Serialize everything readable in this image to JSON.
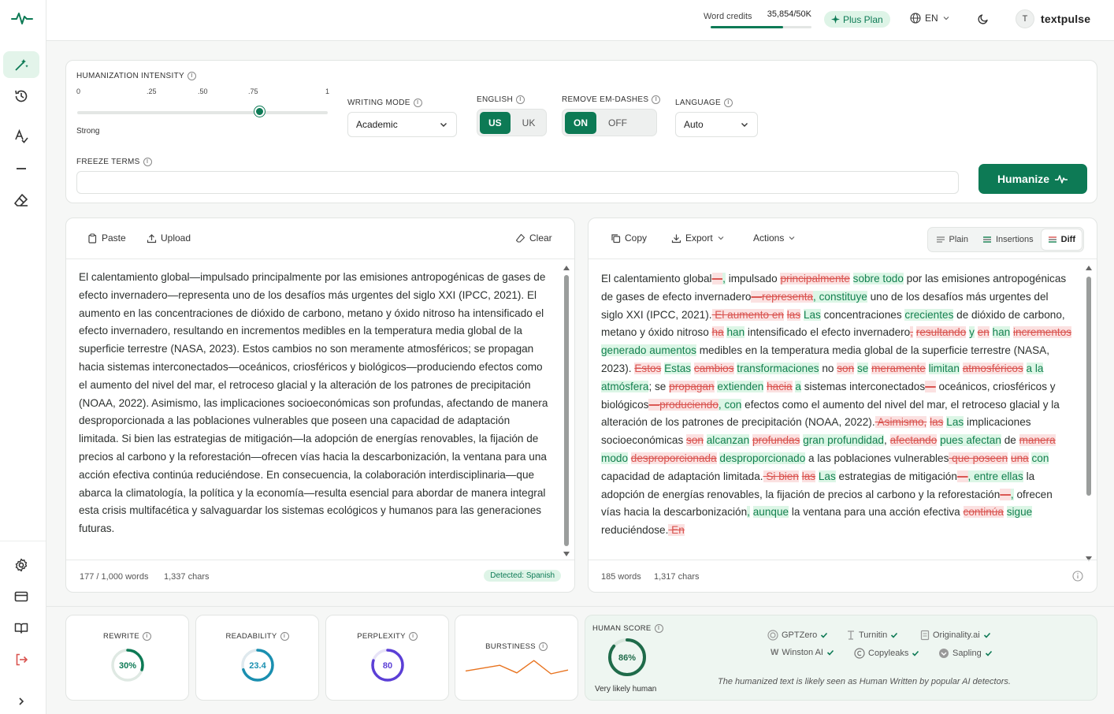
{
  "colors": {
    "accent": "#0d7a55",
    "deleted": "#d9534f",
    "inserted": "#13804f"
  },
  "topbar": {
    "credits_label": "Word credits",
    "credits_value": "35,854/50K",
    "credits_fraction": 0.717,
    "plan": "Plus Plan",
    "language": "EN",
    "user_initial": "T",
    "username": "textpulse"
  },
  "sidebar": {
    "items": [
      "magic-wand-icon",
      "history-icon",
      "spellcheck-icon",
      "dash-icon",
      "eraser-icon",
      "settings-icon",
      "billing-icon",
      "docs-icon",
      "logout-icon",
      "expand-icon"
    ]
  },
  "settings": {
    "intensity_label": "HUMANIZATION INTENSITY",
    "ticks": [
      "0",
      ".25",
      ".50",
      ".75",
      "1"
    ],
    "intensity_value": 0.73,
    "intensity_name": "Strong",
    "writing_mode_label": "WRITING MODE",
    "writing_mode": "Academic",
    "english_label": "ENGLISH",
    "english_opts": [
      "US",
      "UK"
    ],
    "emdash_label": "REMOVE EM-DASHES",
    "emdash_opts": [
      "ON",
      "OFF"
    ],
    "language_label": "LANGUAGE",
    "language": "Auto",
    "freeze_label": "FREEZE TERMS",
    "freeze_value": "",
    "humanize": "Humanize"
  },
  "input": {
    "paste": "Paste",
    "upload": "Upload",
    "clear": "Clear",
    "text": "El calentamiento global—impulsado principalmente por las emisiones antropogénicas de gases de efecto invernadero—representa uno de los desafíos más urgentes del siglo XXI (IPCC, 2021). El aumento en las concentraciones de dióxido de carbono, metano y óxido nitroso ha intensificado el efecto invernadero, resultando en incrementos medibles en la temperatura media global de la superficie terrestre (NASA, 2023). Estos cambios no son meramente atmosféricos; se propagan hacia sistemas interconectados—oceánicos, criosféricos y biológicos—produciendo efectos como el aumento del nivel del mar, el retroceso glacial y la alteración de los patrones de precipitación (NOAA, 2022). Asimismo, las implicaciones socioeconómicas son profundas, afectando de manera desproporcionada a las poblaciones vulnerables que poseen una capacidad de adaptación limitada. Si bien las estrategias de mitigación—la adopción de energías renovables, la fijación de precios al carbono y la reforestación—ofrecen vías hacia la descarbonización, la ventana para una acción efectiva continúa reduciéndose. En consecuencia, la colaboración interdisciplinaria—que abarca la climatología, la política y la economía—resulta esencial para abordar de manera integral esta crisis multifacética y salvaguardar los sistemas ecológicos y humanos para las generaciones futuras.",
    "words": "177 / 1,000 words",
    "chars": "1,337 chars",
    "detected": "Detected: Spanish"
  },
  "output": {
    "copy": "Copy",
    "export": "Export",
    "actions": "Actions",
    "views": [
      "Plain",
      "Insertions",
      "Diff"
    ],
    "active_view": "Diff",
    "segments": [
      [
        "t",
        "El calentamiento global"
      ],
      [
        "d",
        "—"
      ],
      [
        "i",
        ","
      ],
      [
        "t",
        " impulsado "
      ],
      [
        "d",
        "principalmente"
      ],
      [
        "t",
        " "
      ],
      [
        "i",
        "sobre todo"
      ],
      [
        "t",
        " por las emisiones antropogénicas de gases de efecto invernadero"
      ],
      [
        "d",
        "—representa"
      ],
      [
        "i",
        ", constituye"
      ],
      [
        "t",
        " uno de los desafíos más urgentes del siglo XXI (IPCC, 2021)."
      ],
      [
        "d",
        " El aumento en"
      ],
      [
        "t",
        " "
      ],
      [
        "d",
        "las"
      ],
      [
        "t",
        " "
      ],
      [
        "i",
        "Las"
      ],
      [
        "t",
        " concentraciones "
      ],
      [
        "i",
        "crecientes"
      ],
      [
        "t",
        " de dióxido de carbono, metano y óxido nitroso "
      ],
      [
        "d",
        "ha"
      ],
      [
        "t",
        " "
      ],
      [
        "i",
        "han"
      ],
      [
        "t",
        " intensificado el efecto invernadero"
      ],
      [
        "d",
        ","
      ],
      [
        "t",
        " "
      ],
      [
        "d",
        "resultando"
      ],
      [
        "t",
        " "
      ],
      [
        "i",
        "y"
      ],
      [
        "t",
        " "
      ],
      [
        "d",
        "en"
      ],
      [
        "t",
        " "
      ],
      [
        "i",
        "han"
      ],
      [
        "t",
        " "
      ],
      [
        "d",
        "incrementos"
      ],
      [
        "t",
        " "
      ],
      [
        "i",
        "generado aumentos"
      ],
      [
        "t",
        " medibles en la temperatura media global de la superficie terrestre (NASA, 2023). "
      ],
      [
        "d",
        "Estos"
      ],
      [
        "t",
        " "
      ],
      [
        "i",
        "Estas"
      ],
      [
        "t",
        " "
      ],
      [
        "d",
        "cambios"
      ],
      [
        "t",
        " "
      ],
      [
        "i",
        "transformaciones"
      ],
      [
        "t",
        " no "
      ],
      [
        "d",
        "son"
      ],
      [
        "t",
        " "
      ],
      [
        "i",
        "se"
      ],
      [
        "t",
        " "
      ],
      [
        "d",
        "meramente"
      ],
      [
        "t",
        " "
      ],
      [
        "i",
        "limitan"
      ],
      [
        "t",
        " "
      ],
      [
        "d",
        "atmosféricos"
      ],
      [
        "t",
        " "
      ],
      [
        "i",
        "a la atmósfera"
      ],
      [
        "t",
        "; se "
      ],
      [
        "d",
        "propagan"
      ],
      [
        "t",
        " "
      ],
      [
        "i",
        "extienden"
      ],
      [
        "t",
        " "
      ],
      [
        "d",
        "hacia"
      ],
      [
        "t",
        " "
      ],
      [
        "i",
        "a"
      ],
      [
        "t",
        " sistemas interconectados"
      ],
      [
        "d",
        "—"
      ],
      [
        "t",
        " oceánicos, criosféricos y biológicos"
      ],
      [
        "d",
        "—produciendo"
      ],
      [
        "i",
        ", con"
      ],
      [
        "t",
        " efectos como el aumento del nivel del mar, el retroceso glacial y la alteración de los patrones de precipitación (NOAA, 2022)."
      ],
      [
        "d",
        " Asimismo,"
      ],
      [
        "t",
        " "
      ],
      [
        "d",
        "las"
      ],
      [
        "t",
        " "
      ],
      [
        "i",
        "Las"
      ],
      [
        "t",
        " implicaciones socioeconómicas "
      ],
      [
        "d",
        "son"
      ],
      [
        "t",
        " "
      ],
      [
        "i",
        "alcanzan"
      ],
      [
        "t",
        " "
      ],
      [
        "d",
        "profundas"
      ],
      [
        "t",
        " "
      ],
      [
        "i",
        "gran profundidad"
      ],
      [
        "t",
        ", "
      ],
      [
        "d",
        "afectando"
      ],
      [
        "t",
        " "
      ],
      [
        "i",
        "pues afectan"
      ],
      [
        "t",
        " de "
      ],
      [
        "d",
        "manera"
      ],
      [
        "t",
        " "
      ],
      [
        "i",
        "modo"
      ],
      [
        "t",
        " "
      ],
      [
        "d",
        "desproporcionada"
      ],
      [
        "t",
        " "
      ],
      [
        "i",
        "desproporcionado"
      ],
      [
        "t",
        " a las poblaciones vulnerables"
      ],
      [
        "d",
        " que poseen"
      ],
      [
        "t",
        " "
      ],
      [
        "d",
        "una"
      ],
      [
        "t",
        " "
      ],
      [
        "i",
        "con"
      ],
      [
        "t",
        " capacidad de adaptación limitada."
      ],
      [
        "d",
        " Si bien"
      ],
      [
        "t",
        " "
      ],
      [
        "d",
        "las"
      ],
      [
        "t",
        " "
      ],
      [
        "i",
        "Las"
      ],
      [
        "t",
        " estrategias de mitigación"
      ],
      [
        "d",
        "—"
      ],
      [
        "i",
        ", entre ellas"
      ],
      [
        "t",
        " la adopción de energías renovables, la fijación de precios al carbono y la reforestación"
      ],
      [
        "d",
        "—"
      ],
      [
        "i",
        ","
      ],
      [
        "t",
        " ofrecen vías hacia la descarbonización"
      ],
      [
        "i",
        ","
      ],
      [
        "t",
        " "
      ],
      [
        "i",
        "aunque"
      ],
      [
        "t",
        " la ventana para una acción efectiva "
      ],
      [
        "d",
        "continúa"
      ],
      [
        "t",
        " "
      ],
      [
        "i",
        "sigue"
      ],
      [
        "t",
        " reduciéndose."
      ],
      [
        "d",
        " En"
      ]
    ],
    "words": "185 words",
    "chars": "1,317 chars"
  },
  "metrics": {
    "rewrite": {
      "label": "REWRITE",
      "display": "30%",
      "value": 0.3,
      "color": "#0d7a55"
    },
    "readability": {
      "label": "READABILITY",
      "display": "23.4",
      "value": 0.7,
      "color": "#1a8fb0"
    },
    "perplexity": {
      "label": "PERPLEXITY",
      "display": "80",
      "value": 0.8,
      "color": "#5b3fd6"
    },
    "burstiness": {
      "label": "BURSTINESS",
      "series": [
        0.4,
        0.55,
        0.7,
        0.3,
        0.95,
        0.25,
        0.45
      ]
    },
    "human": {
      "label": "HUMAN SCORE",
      "display": "86%",
      "value": 0.86,
      "verdict": "Very likely human",
      "detectors": [
        "GPTZero",
        "Turnitin",
        "Originality.ai",
        "Winston AI",
        "Copyleaks",
        "Sapling"
      ],
      "note": "The humanized text is likely seen as Human Written by popular AI detectors."
    }
  }
}
